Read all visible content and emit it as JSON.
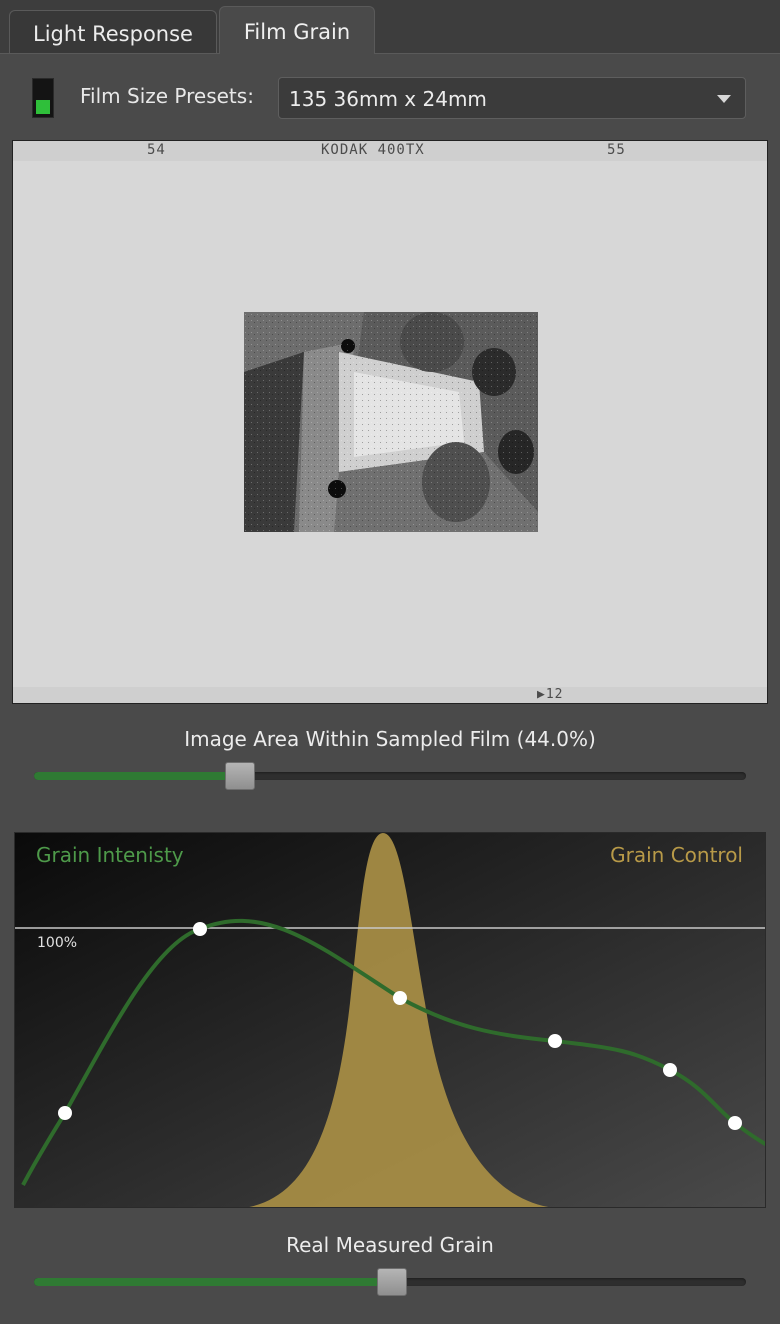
{
  "tabs": [
    {
      "label": "Light Response",
      "active": false
    },
    {
      "label": "Film Grain",
      "active": true
    }
  ],
  "film_size": {
    "label": "Film Size Presets:",
    "value": "135 36mm x 24mm"
  },
  "film_edge": {
    "left_number": "54",
    "brand": "KODAK  400TX",
    "right_number": "55",
    "bottom_marker": "▶12"
  },
  "image_area_slider": {
    "label": "Image Area Within Sampled Film (44.0%)",
    "value_fraction": 0.29
  },
  "grain_graph": {
    "left_label": "Grain Intenisty",
    "right_label": "Grain Control",
    "reference_label": "100%",
    "colors": {
      "intensity_curve": "#2f6b2c",
      "control_peak": "#a58c45",
      "point": "#ffffff"
    }
  },
  "measured_grain_slider": {
    "label": "Real Measured Grain",
    "value_fraction": 0.503
  }
}
